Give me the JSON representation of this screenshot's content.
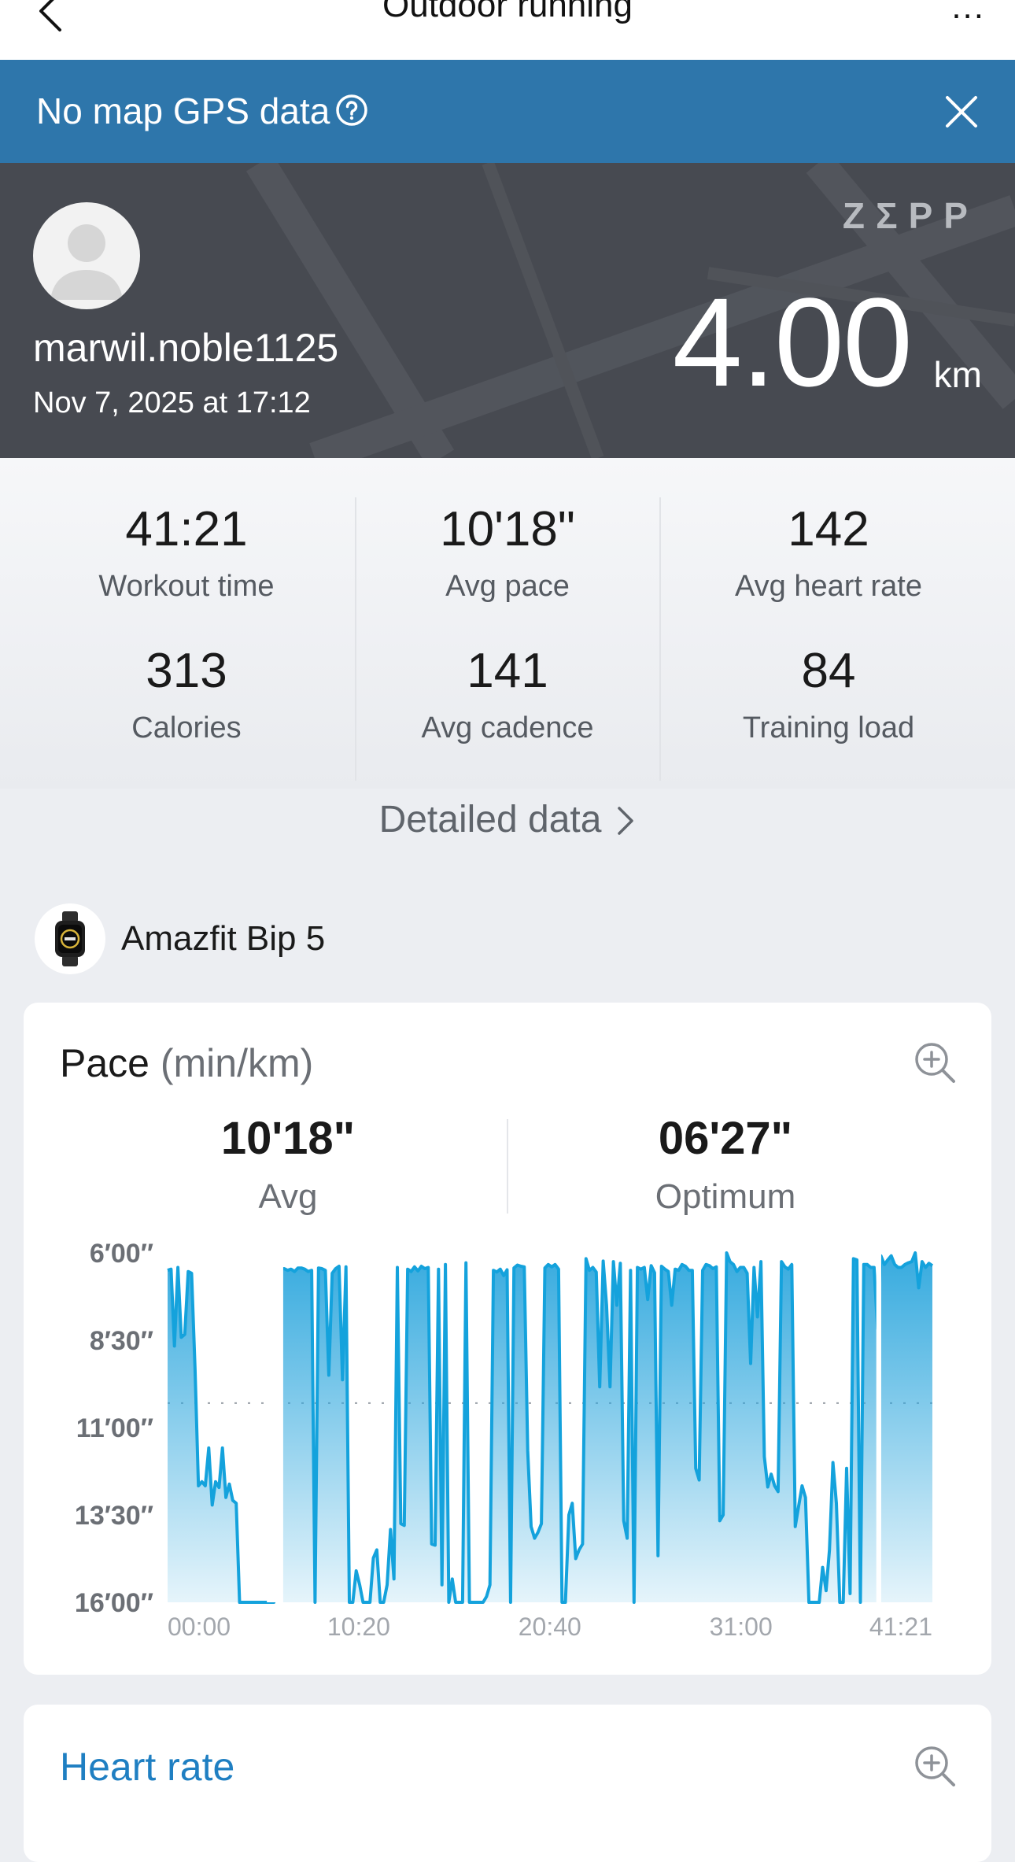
{
  "header": {
    "title": "Outdoor running",
    "more": "..."
  },
  "gps_banner": {
    "text": "No map GPS data"
  },
  "hero": {
    "username": "marwil.noble1125",
    "datetime": "Nov 7, 2025 at 17:12",
    "brand": "ZΣPP",
    "distance": "4.00",
    "distance_unit": "km"
  },
  "stats": [
    {
      "value": "41:21",
      "label": "Workout time"
    },
    {
      "value": "10'18\"",
      "label": "Avg pace"
    },
    {
      "value": "142",
      "label": "Avg heart rate"
    },
    {
      "value": "313",
      "label": "Calories"
    },
    {
      "value": "141",
      "label": "Avg cadence"
    },
    {
      "value": "84",
      "label": "Training load"
    }
  ],
  "detailed_link": "Detailed data",
  "device": {
    "name": "Amazfit Bip 5"
  },
  "pace_card": {
    "title": "Pace",
    "unit": "(min/km)",
    "avg_value": "10'18\"",
    "avg_label": "Avg",
    "optimum_value": "06'27\"",
    "optimum_label": "Optimum"
  },
  "chart_data": {
    "type": "area",
    "y_tick_labels": [
      "6′00″",
      "8′30″",
      "11′00″",
      "13′30″",
      "16′00″"
    ],
    "x_tick_labels": [
      "00:00",
      "10:20",
      "20:40",
      "31:00",
      "41:21"
    ],
    "y_axis_seconds_per_km": [
      360,
      960
    ],
    "y_inverted": true,
    "x_range_seconds": [
      0,
      2481
    ],
    "avg_line_pace": "10'18\"",
    "gaps": [
      [
        322,
        375
      ],
      [
        2299,
        2315
      ]
    ],
    "series": [
      {
        "pace_seconds_per_km": [
          390,
          388,
          520,
          385,
          505,
          500,
          392,
          395,
          560,
          760,
          753,
          760,
          695,
          793,
          753,
          763,
          695,
          780,
          757,
          785,
          790,
          960,
          960,
          960,
          960,
          960,
          960,
          960,
          960,
          960,
          960,
          960,
          390,
          388,
          387,
          390,
          388,
          392,
          386,
          386,
          388,
          392,
          390,
          960,
          386,
          387,
          390,
          570,
          395,
          387,
          383,
          578,
          384,
          960,
          960,
          906,
          930,
          960,
          960,
          960,
          884,
          870,
          960,
          960,
          930,
          835,
          920,
          385,
          825,
          828,
          388,
          392,
          384,
          391,
          383,
          387,
          385,
          860,
          862,
          388,
          930,
          380,
          960,
          920,
          960,
          960,
          960,
          377,
          960,
          960,
          960,
          960,
          960,
          950,
          930,
          390,
          393,
          388,
          399,
          389,
          960,
          386,
          381,
          383,
          384,
          700,
          830,
          850,
          840,
          825,
          386,
          380,
          384,
          380,
          388,
          960,
          960,
          810,
          790,
          885,
          870,
          860,
          370,
          390,
          385,
          393,
          590,
          374,
          450,
          590,
          375,
          450,
          378,
          820,
          850,
          390,
          960,
          385,
          388,
          385,
          440,
          382,
          394,
          880,
          383,
          388,
          392,
          450,
          388,
          390,
          380,
          383,
          390,
          390,
          730,
          750,
          390,
          380,
          382,
          387,
          384,
          820,
          810,
          360,
          375,
          380,
          392,
          385,
          385,
          395,
          550,
          385,
          470,
          375,
          710,
          762,
          740,
          760,
          770,
          375,
          384,
          388,
          380,
          830,
          795,
          760,
          780,
          960,
          960,
          960,
          960,
          900,
          940,
          870,
          720,
          790,
          960,
          960,
          730,
          945,
          370,
          372,
          960,
          380,
          380,
          385,
          385,
          490,
          365,
          380,
          372,
          365,
          380,
          385,
          385,
          380,
          377,
          375,
          360,
          420,
          375,
          385,
          378,
          382
        ]
      }
    ]
  }
}
